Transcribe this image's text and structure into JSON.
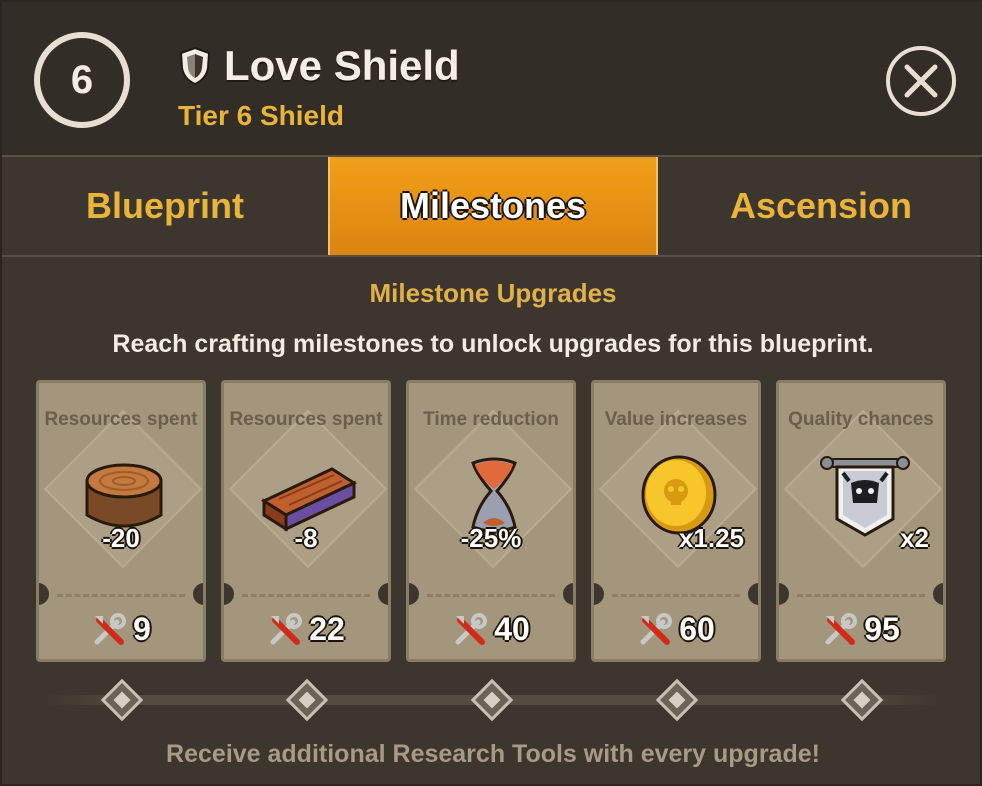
{
  "header": {
    "tier_number": "6",
    "title": "Love Shield",
    "subtitle": "Tier 6 Shield",
    "icon": "shield-icon",
    "close_icon": "close-icon"
  },
  "tabs": [
    {
      "label": "Blueprint",
      "active": false
    },
    {
      "label": "Milestones",
      "active": true
    },
    {
      "label": "Ascension",
      "active": false
    }
  ],
  "section": {
    "title": "Milestone Upgrades",
    "description": "Reach crafting milestones to unlock upgrades for this blueprint."
  },
  "milestones": [
    {
      "label": "Resources spent",
      "icon": "wood-log-icon",
      "value": "-20",
      "crafts": "9"
    },
    {
      "label": "Resources spent",
      "icon": "wood-plank-icon",
      "value": "-8",
      "crafts": "22"
    },
    {
      "label": "Time reduction",
      "icon": "hourglass-icon",
      "value": "-25%",
      "crafts": "40"
    },
    {
      "label": "Value increases",
      "icon": "gold-coin-icon",
      "value": "x1.25",
      "crafts": "60"
    },
    {
      "label": "Quality chances",
      "icon": "skull-banner-icon",
      "value": "x2",
      "crafts": "95"
    }
  ],
  "footer": "Receive additional Research Tools with every upgrade!",
  "colors": {
    "accent_gold": "#e8b43a",
    "active_tab": "#f0a018",
    "card_bg": "#a4967c"
  }
}
